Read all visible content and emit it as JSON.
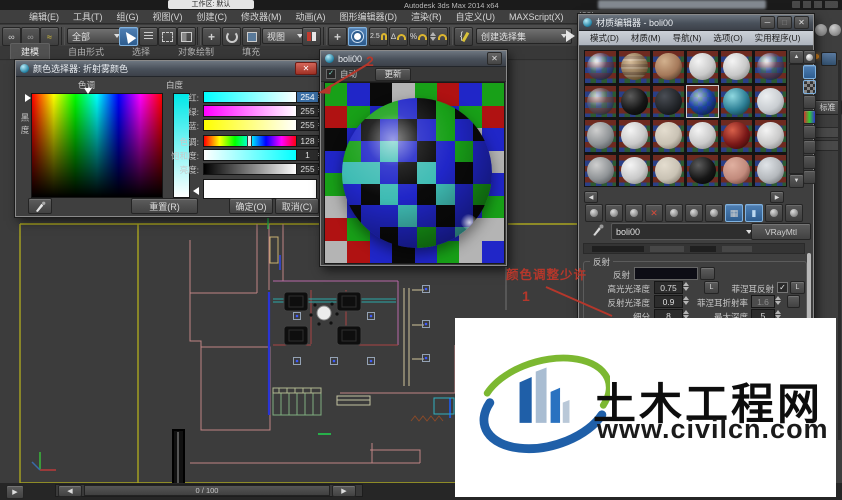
{
  "titlebar": {
    "workspace": "工作区: 默认",
    "app_title": "Autodesk 3ds Max 2014 x64"
  },
  "menu_bar": {
    "items": [
      "编辑(E)",
      "工具(T)",
      "组(G)",
      "视图(V)",
      "创建(C)",
      "修改器(M)",
      "动画(A)",
      "图形编辑器(D)",
      "渲染(R)",
      "自定义(U)",
      "MAXScript(X)",
      "帮助(H)"
    ]
  },
  "toolbar": {
    "filter_dropdown": "全部",
    "view_dropdown": "视图",
    "snap_label": "2.5",
    "selection_set_dropdown": "创建选择集"
  },
  "ribbon": {
    "tabs": [
      "建模",
      "自由形式",
      "选择",
      "对象绘制",
      "填充"
    ],
    "active_tab": "建模"
  },
  "color_picker": {
    "title": "颜色选择器: 折射雾颜色",
    "hue_label": "色调",
    "whiteness_label": "白度",
    "blackness_label": "黑度",
    "channels": [
      {
        "label": "红:",
        "value": "254",
        "selected": true
      },
      {
        "label": "绿:",
        "value": "255",
        "selected": false
      },
      {
        "label": "蓝:",
        "value": "255",
        "selected": false
      },
      {
        "label": "色调:",
        "value": "128",
        "selected": false
      },
      {
        "label": "饱和度:",
        "value": "1",
        "selected": false
      },
      {
        "label": "亮度:",
        "value": "255",
        "selected": false
      }
    ],
    "reset_button": "重置(R)",
    "ok_button": "确定(O)",
    "cancel_button": "取消(C)"
  },
  "preview_window": {
    "title": "boli00",
    "auto_label": "自动",
    "update_label": "更新"
  },
  "material_editor": {
    "title": "材质编辑器 - boli00",
    "menus": [
      "模式(D)",
      "材质(M)",
      "导航(N)",
      "选项(O)",
      "实用程序(U)"
    ],
    "material_name": "boli00",
    "material_type_button": "VRayMtl",
    "slots": [
      [
        "glass",
        "jupiter",
        "stone-brown",
        "white",
        "white",
        "glass"
      ],
      [
        "glass-blue",
        "black",
        "dark",
        "blue-checker",
        "teal",
        "light"
      ],
      [
        "gray",
        "white",
        "stone",
        "white",
        "marble-red",
        "white"
      ],
      [
        "gray",
        "white",
        "stone",
        "black",
        "marble-pink",
        "silver"
      ]
    ],
    "reflection": {
      "group_title": "反射",
      "reflect_label": "反射",
      "hilight_gloss_label": "高光光泽度",
      "hilight_gloss_value": "0.75",
      "l_button": "L",
      "fresnel_label": "菲涅耳反射",
      "refl_gloss_label": "反射光泽度",
      "refl_gloss_value": "0.9",
      "fresnel_ior_label": "菲涅耳折射率",
      "fresnel_ior_value": "1.6",
      "subdivs_label": "细分",
      "subdivs_value": "8",
      "max_depth_label": "最大深度",
      "max_depth_value": "5"
    }
  },
  "command_panel": {
    "standard_button": "标准"
  },
  "timeline": {
    "frame_label": "0 / 100"
  },
  "annotations": {
    "step_1": "1",
    "step_2": "2",
    "note": "颜色调整少许",
    "color": "#b5372b"
  },
  "logo": {
    "name": "土木工程网",
    "url": "www.civilcn.com",
    "green": "#7cb831",
    "blue": "#1f5fa8"
  },
  "preview_colors": {
    "g": "#18a018",
    "b": "#2026c8",
    "r": "#b01212",
    "s": "#b4b4b4",
    "k": "#0a0a0a",
    "t": "#3fbcb4"
  },
  "preview_bg_grid": [
    [
      "g",
      "b",
      "k",
      "s",
      "g",
      "r",
      "b",
      "g"
    ],
    [
      "r",
      "g",
      "b",
      "g",
      "k",
      "b",
      "g",
      "r"
    ],
    [
      "k",
      "b",
      "g",
      "r",
      "b",
      "g",
      "s",
      "b"
    ],
    [
      "b",
      "s",
      "k",
      "g",
      "b",
      "k",
      "b",
      "s"
    ],
    [
      "g",
      "k",
      "b",
      "s",
      "g",
      "b",
      "r",
      "b"
    ],
    [
      "s",
      "b",
      "g",
      "b",
      "k",
      "g",
      "b",
      "g"
    ],
    [
      "r",
      "g",
      "b",
      "k",
      "g",
      "b",
      "s",
      "s"
    ],
    [
      "s",
      "r",
      "b",
      "k",
      "b",
      "g",
      "s",
      "b"
    ]
  ],
  "preview_sphere_grid": [
    [
      "k",
      "g",
      "g",
      "b",
      "k",
      "g",
      "k",
      "b"
    ],
    [
      "b",
      "k",
      "b",
      "k",
      "b",
      "g",
      "b",
      "k"
    ],
    [
      "g",
      "b",
      "t",
      "b",
      "k",
      "b",
      "g",
      "b"
    ],
    [
      "t",
      "t",
      "b",
      "k",
      "t",
      "b",
      "k",
      "b"
    ],
    [
      "b",
      "k",
      "t",
      "b",
      "k",
      "t",
      "b",
      "g"
    ],
    [
      "k",
      "b",
      "b",
      "t",
      "b",
      "k",
      "b",
      "k"
    ],
    [
      "g",
      "b",
      "k",
      "b",
      "g",
      "b",
      "t",
      "b"
    ]
  ]
}
